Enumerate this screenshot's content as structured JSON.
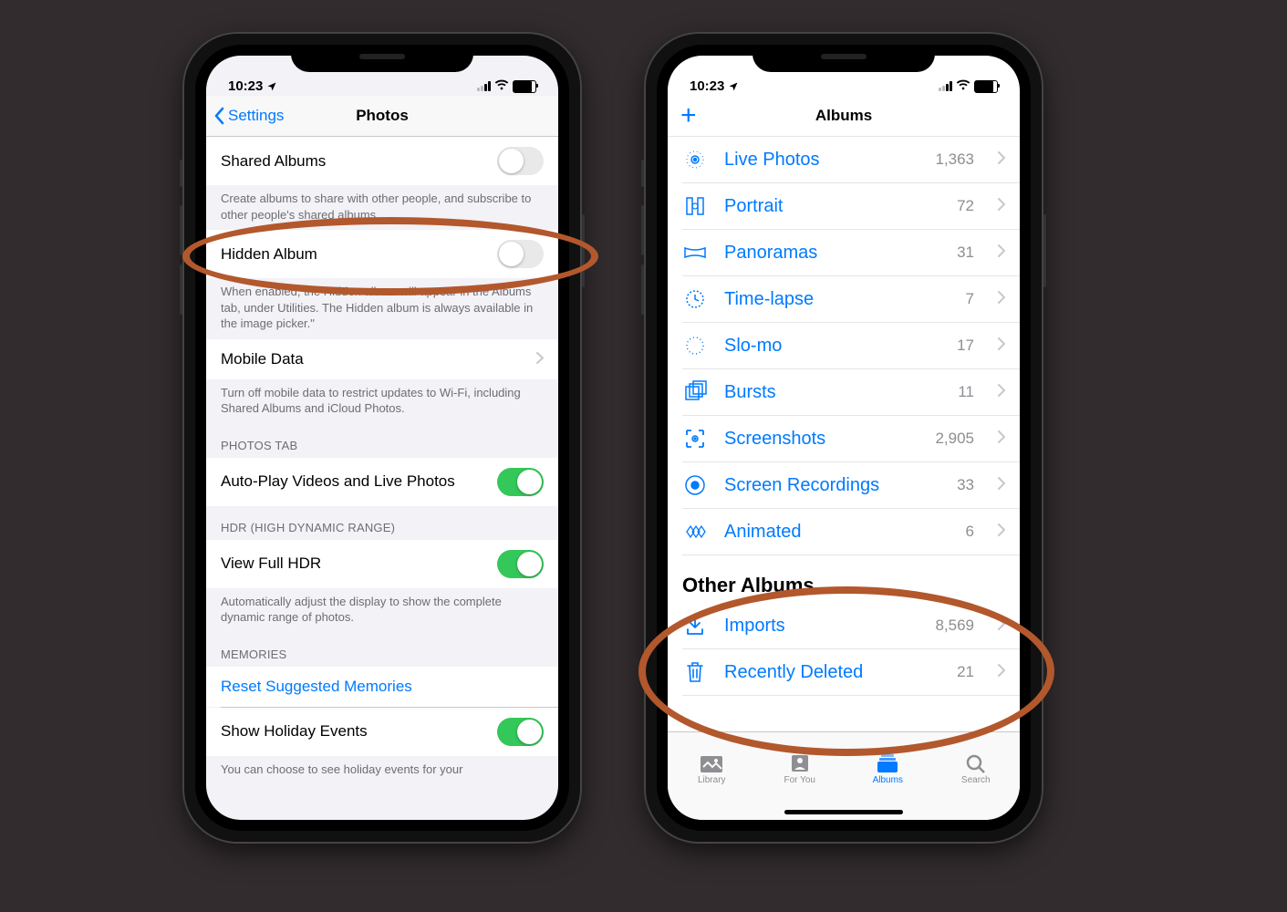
{
  "status": {
    "time": "10:23",
    "location_icon": "location-arrow"
  },
  "settings": {
    "back_label": "Settings",
    "title": "Photos",
    "rows": {
      "shared_albums_label": "Shared Albums",
      "shared_albums_on": false,
      "shared_albums_caption": "Create albums to share with other people, and subscribe to other people's shared albums.",
      "hidden_album_label": "Hidden Album",
      "hidden_album_on": false,
      "hidden_album_caption": "When enabled, the Hidden album will appear in the Albums tab, under Utilities. The Hidden album is always available in the image picker.\"",
      "mobile_data_label": "Mobile Data",
      "mobile_data_caption": "Turn off mobile data to restrict updates to Wi-Fi, including Shared Albums and iCloud Photos.",
      "section_photos_tab": "PHOTOS TAB",
      "autoplay_label": "Auto-Play Videos and Live Photos",
      "autoplay_on": true,
      "section_hdr": "HDR (HIGH DYNAMIC RANGE)",
      "hdr_label": "View Full HDR",
      "hdr_on": true,
      "hdr_caption": "Automatically adjust the display to show the complete dynamic range of photos.",
      "section_memories": "MEMORIES",
      "reset_memories_label": "Reset Suggested Memories",
      "holiday_label": "Show Holiday Events",
      "holiday_on": true,
      "holiday_caption": "You can choose to see holiday events for your"
    }
  },
  "albums": {
    "title": "Albums",
    "media_types": [
      {
        "icon": "live-photos",
        "name": "Live Photos",
        "count": "1,363"
      },
      {
        "icon": "portrait",
        "name": "Portrait",
        "count": "72"
      },
      {
        "icon": "panoramas",
        "name": "Panoramas",
        "count": "31"
      },
      {
        "icon": "time-lapse",
        "name": "Time-lapse",
        "count": "7"
      },
      {
        "icon": "slo-mo",
        "name": "Slo-mo",
        "count": "17"
      },
      {
        "icon": "bursts",
        "name": "Bursts",
        "count": "11"
      },
      {
        "icon": "screenshots",
        "name": "Screenshots",
        "count": "2,905"
      },
      {
        "icon": "screen-recordings",
        "name": "Screen Recordings",
        "count": "33"
      },
      {
        "icon": "animated",
        "name": "Animated",
        "count": "6"
      }
    ],
    "other_section_title": "Other Albums",
    "other_albums": [
      {
        "icon": "imports",
        "name": "Imports",
        "count": "8,569"
      },
      {
        "icon": "recently-deleted",
        "name": "Recently Deleted",
        "count": "21"
      }
    ],
    "tabs": [
      {
        "id": "library",
        "label": "Library",
        "active": false
      },
      {
        "id": "for-you",
        "label": "For You",
        "active": false
      },
      {
        "id": "albums",
        "label": "Albums",
        "active": true
      },
      {
        "id": "search",
        "label": "Search",
        "active": false
      }
    ]
  }
}
